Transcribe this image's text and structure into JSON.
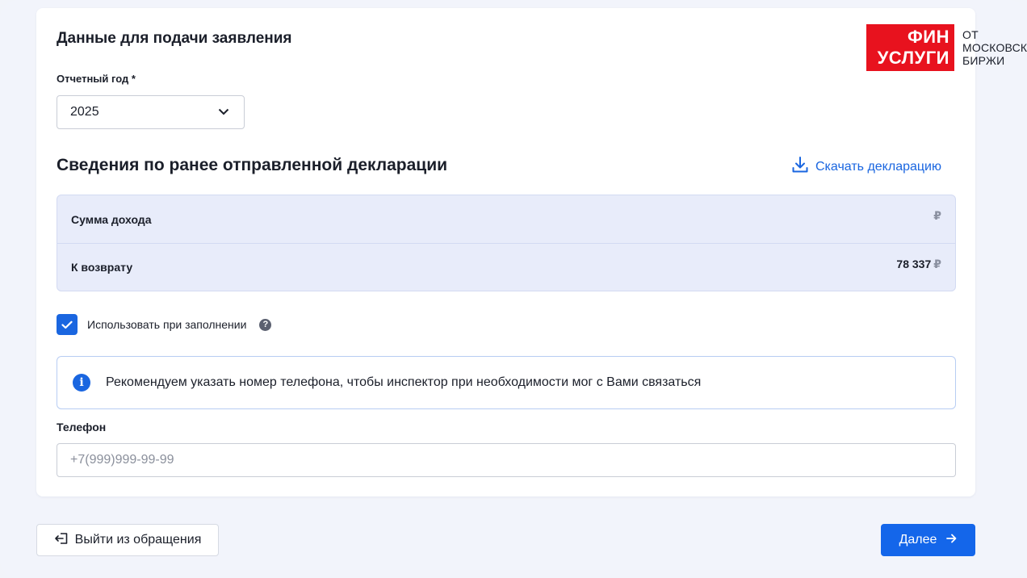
{
  "logo": {
    "red_line1": "ФИН",
    "red_line2": "УСЛУГИ",
    "text_line1": "ОТ",
    "text_line2": "МОСКОВСКОЙ",
    "text_line3": "БИРЖИ",
    "brand_color": "#e8121e"
  },
  "form": {
    "title": "Данные для подачи заявления",
    "year_label": "Отчетный год *",
    "year_value": "2025",
    "year_icon": "chevron-down-icon"
  },
  "declaration": {
    "title": "Сведения по ранее отправленной декларации",
    "download_label": "Скачать декларацию",
    "download_icon": "download-icon",
    "rows": [
      {
        "label": "Сумма дохода",
        "value": "",
        "currency": "₽"
      },
      {
        "label": "К возврату",
        "value": "78 337",
        "currency": "₽"
      }
    ]
  },
  "use_checkbox": {
    "label": "Использовать при заполнении",
    "checked": true,
    "help_icon": "question-icon"
  },
  "notice": {
    "icon": "info-icon",
    "text": "Рекомендуем указать номер телефона, чтобы инспектор при необходимости мог с Вами связаться"
  },
  "phone": {
    "label": "Телефон",
    "placeholder": "+7(999)999-99-99",
    "value": ""
  },
  "footer": {
    "exit_label": "Выйти из обращения",
    "exit_icon": "exit-icon",
    "next_label": "Далее",
    "next_icon": "arrow-right-icon"
  },
  "colors": {
    "accent": "#1466ea",
    "table_bg": "#e8ecfa"
  }
}
